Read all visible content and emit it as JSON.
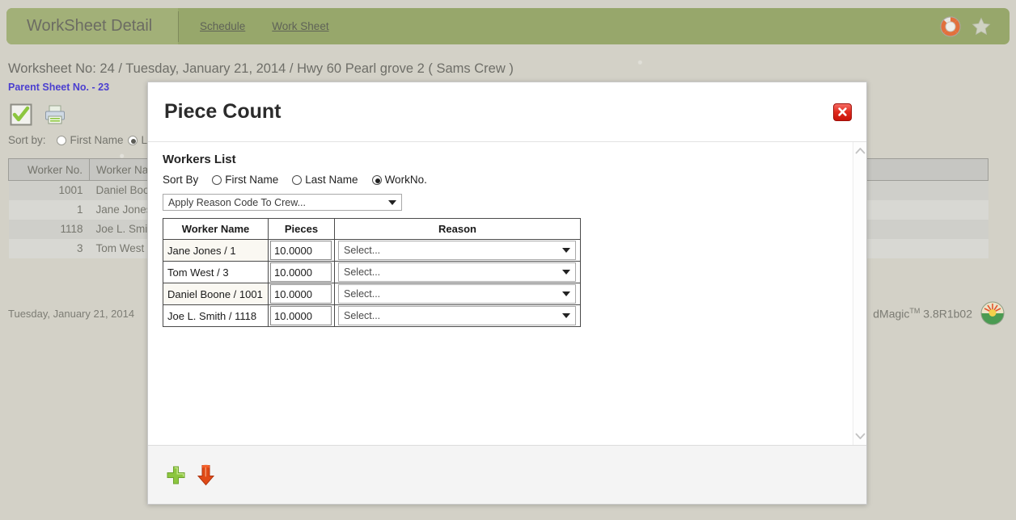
{
  "header": {
    "brand_tab": "WorkSheet Detail",
    "nav": [
      {
        "label": "Schedule"
      },
      {
        "label": "Work Sheet"
      }
    ],
    "icons": {
      "help": "lifebuoy-icon",
      "favorite": "star-icon"
    }
  },
  "page": {
    "worksheet_line": "Worksheet No: 24 / Tuesday, January 21, 2014 / Hwy 60 Pearl grove 2 ( Sams Crew )",
    "parent_sheet": "Parent Sheet No. - 23",
    "toolbar_icons": {
      "approve": "checkmark-icon",
      "print": "printer-icon"
    },
    "sort_by": {
      "label": "Sort by:",
      "options": [
        {
          "label": "First Name",
          "selected": false
        },
        {
          "label": "Last Name",
          "selected": true
        }
      ]
    },
    "table": {
      "columns": [
        "Worker No.",
        "Worker Name"
      ],
      "rows": [
        {
          "no": "1001",
          "name": "Daniel Boone"
        },
        {
          "no": "1",
          "name": "Jane Jones"
        },
        {
          "no": "1118",
          "name": "Joe L. Smith"
        },
        {
          "no": "3",
          "name": "Tom West"
        }
      ]
    },
    "footer": {
      "date": "Tuesday, January 21, 2014",
      "version_name": "dMagic",
      "version_sup": "TM",
      "version_num": " 3.8R1b02"
    }
  },
  "modal": {
    "title": "Piece Count",
    "close_icon": "close-icon",
    "section_title": "Workers List",
    "sort_by": {
      "label": "Sort By",
      "options": [
        {
          "label": "First Name",
          "selected": false
        },
        {
          "label": "Last Name",
          "selected": false
        },
        {
          "label": "WorkNo.",
          "selected": true
        }
      ]
    },
    "crew_select": {
      "value": "Apply Reason Code To Crew...",
      "caret": "chevron-down-icon"
    },
    "table": {
      "columns": [
        "Worker Name",
        "Pieces",
        "Reason"
      ],
      "rows": [
        {
          "name": "Jane Jones / 1",
          "pieces": "10.0000",
          "reason": "Select..."
        },
        {
          "name": "Tom West / 3",
          "pieces": "10.0000",
          "reason": "Select..."
        },
        {
          "name": "Daniel Boone / 1001",
          "pieces": "10.0000",
          "reason": "Select..."
        },
        {
          "name": "Joe L. Smith / 1118",
          "pieces": "10.0000",
          "reason": "Select..."
        }
      ]
    },
    "scrollbar": {
      "up": "chevron-up-icon",
      "down": "chevron-down-icon"
    },
    "footer_actions": [
      {
        "name": "add-row-button",
        "icon": "plus-icon"
      },
      {
        "name": "save-button",
        "icon": "down-arrow-icon"
      }
    ]
  },
  "colors": {
    "header_green": "#97a76b",
    "header_tab_green": "#a2b078",
    "page_background": "#d3d1c7",
    "link_blue": "#4b3fd0",
    "close_red": "#e02a1d",
    "plus_green": "#8cc63f",
    "arrow_orange": "#e04a17"
  }
}
